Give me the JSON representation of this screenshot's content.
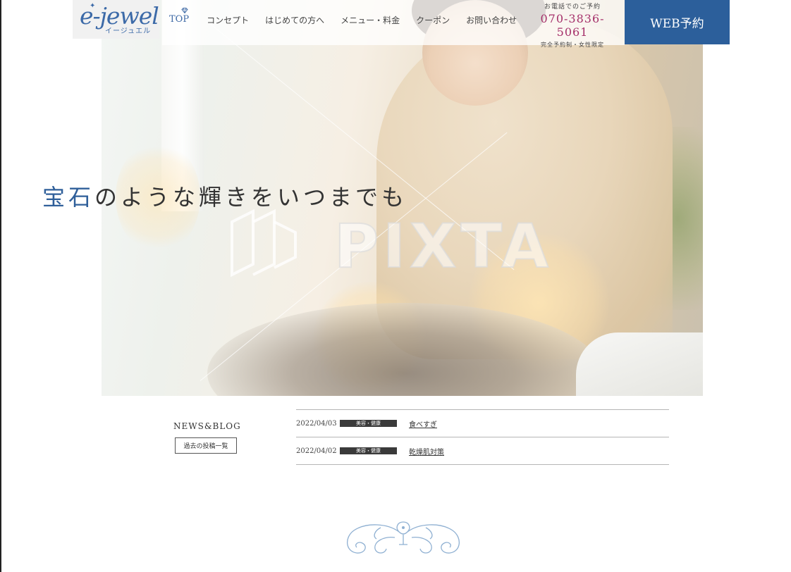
{
  "brand": {
    "logo_text": "e-jewel",
    "logo_subtext": "イージュエル"
  },
  "nav": {
    "items": [
      {
        "label": "TOP",
        "active": true
      },
      {
        "label": "コンセプト"
      },
      {
        "label": "はじめての方へ"
      },
      {
        "label": "メニュー・料金"
      },
      {
        "label": "クーポン"
      },
      {
        "label": "お問い合わせ"
      }
    ]
  },
  "contact": {
    "label": "お電話でのご予約",
    "phone": "070-3836-5061",
    "note": "完全予約制・女性限定"
  },
  "cta": {
    "web_reserve": "WEB予約"
  },
  "hero": {
    "tagline_accent": "宝石",
    "tagline_rest": "のような輝きをいつまでも",
    "watermark": "PIXTA"
  },
  "news": {
    "title": "NEWS&BLOG",
    "archive_label": "過去の投稿一覧",
    "posts": [
      {
        "date": "2022/04/03",
        "category": "美容・健康",
        "title": "食べすぎ"
      },
      {
        "date": "2022/04/02",
        "category": "美容・健康",
        "title": "乾燥肌対策"
      }
    ]
  },
  "colors": {
    "accent_blue": "#2c5f9b",
    "phone_magenta": "#a5306a",
    "category_badge": "#3a3a3a"
  }
}
